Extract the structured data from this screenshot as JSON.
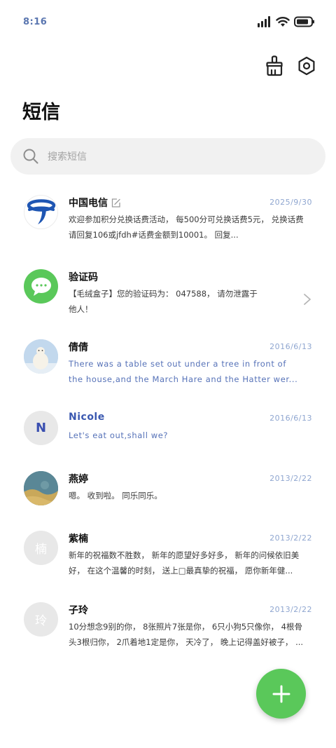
{
  "status_bar": {
    "time": "8:16",
    "icons": [
      "signal-icon",
      "wifi-icon",
      "battery-icon"
    ]
  },
  "header": {
    "title": "短信",
    "actions": [
      "clean-brush-icon",
      "settings-gear-icon"
    ]
  },
  "search": {
    "placeholder": "搜索短信"
  },
  "threads": [
    {
      "name": "中国电信",
      "date": "2025/9/30",
      "line1": "欢迎参加积分兑换话费活动， 每500分可兑换话费5元， 兑换话费",
      "line2": "请回复106或jfdh#话费金额到10001。 回复..."
    },
    {
      "name": "验证码",
      "date": "",
      "line1": "【毛绒盒子】您的验证码为： 047588， 请勿泄露于",
      "line2": "他人！"
    },
    {
      "name": "倩倩",
      "date": "2016/6/13",
      "line1": "There was a table set out under a tree in front of",
      "line2": "the house,and the March Hare and the Hatter wer..."
    },
    {
      "name": "Nicole",
      "avatar_letter": "N",
      "date": "2016/6/13",
      "line1": "Let's eat out,shall we?",
      "line2": ""
    },
    {
      "name": "燕婷",
      "date": "2013/2/22",
      "line1": "嗯。 收到啦。 同乐同乐。",
      "line2": ""
    },
    {
      "name": "紫楠",
      "avatar_letter": "楠",
      "date": "2013/2/22",
      "line1": "新年的祝福数不胜数， 新年的愿望好多好多， 新年的问候依旧美",
      "line2": "好， 在这个温馨的时刻， 送上□最真挚的祝福， 愿你新年健..."
    },
    {
      "name": "子玲",
      "avatar_letter": "玲",
      "date": "2013/2/22",
      "line1": "10分想念9别的你， 8张照片7张是你， 6只小狗5只像你， 4根骨",
      "line2": "头3根归你， 2爪着地1定是你， 天冷了， 晚上记得盖好被子， ..."
    }
  ],
  "colors": {
    "accent": "#5ac85a",
    "link_blue": "#3a58b0",
    "date_blue": "#8fa6d0"
  },
  "fab": {
    "icon": "plus-icon"
  }
}
